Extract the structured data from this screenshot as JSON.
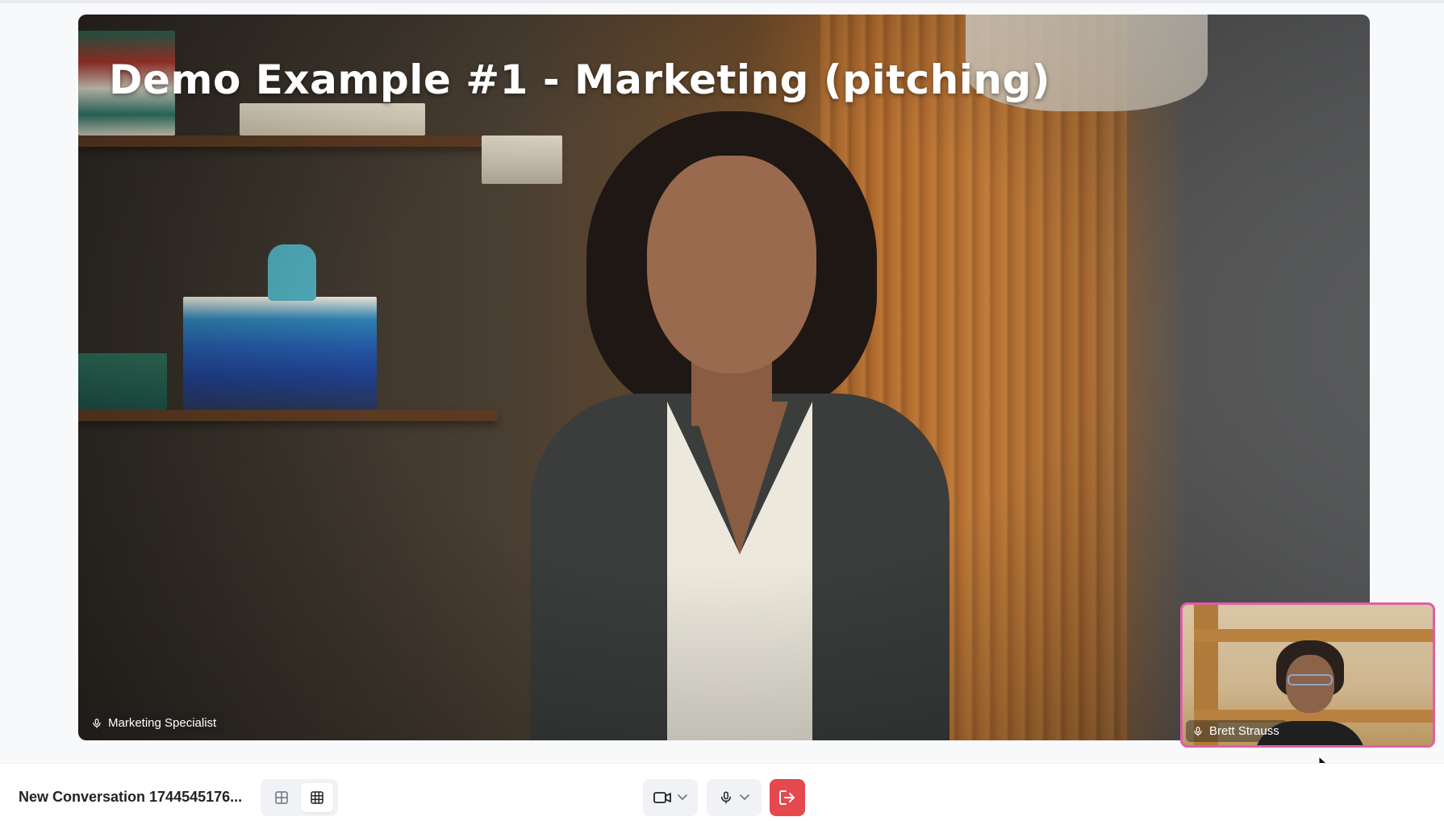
{
  "video": {
    "title": "Demo Example #1 - Marketing (pitching)",
    "speaker_name": "Marketing Specialist"
  },
  "self_view": {
    "name": "Brett Strauss",
    "border_color": "#e05ea8"
  },
  "bottom_bar": {
    "conversation_title": "New Conversation 1744545176...",
    "layout_options": [
      "grid-2x2-icon",
      "grid-3x3-icon"
    ],
    "active_layout": "grid-3x3-icon",
    "controls": [
      "camera-icon",
      "microphone-icon",
      "leave-icon"
    ],
    "leave_color": "#e5484d"
  }
}
